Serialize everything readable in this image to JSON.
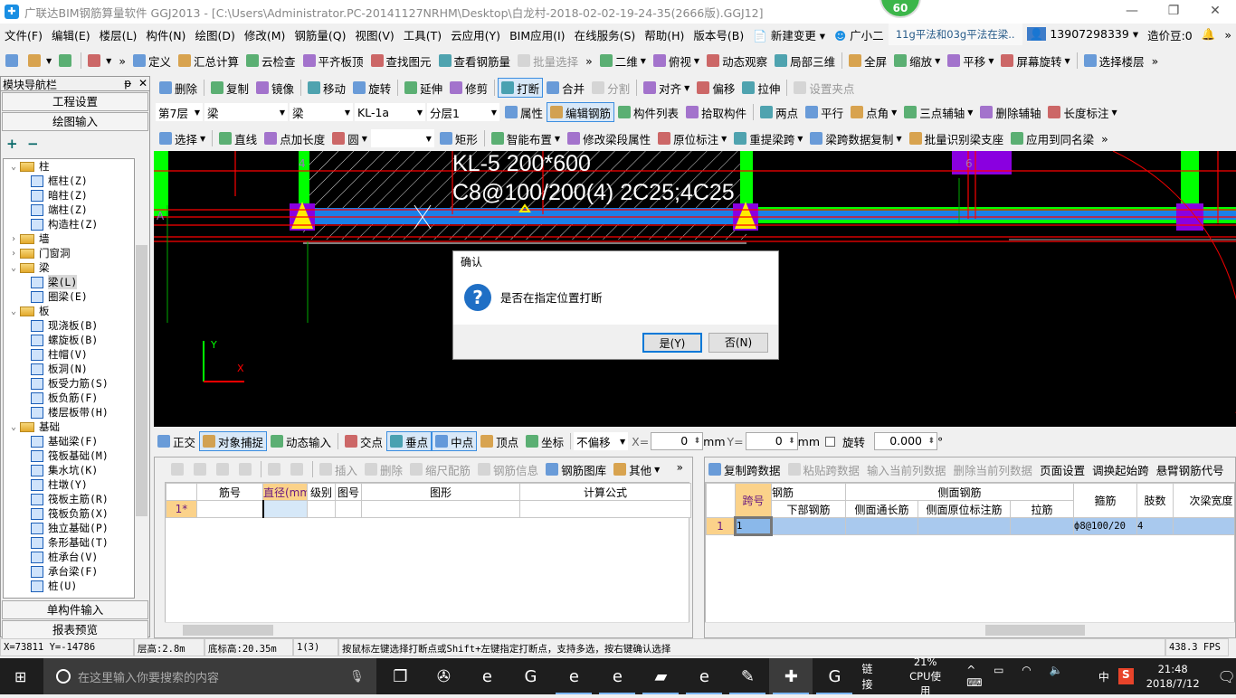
{
  "title": "广联达BIM钢筋算量软件 GGJ2013 - [C:\\Users\\Administrator.PC-20141127NRHM\\Desktop\\白龙村-2018-02-02-19-24-35(2666版).GGJ12]",
  "badge": "60",
  "window_controls": {
    "minimize": "—",
    "restore": "❐",
    "close": "✕"
  },
  "menu": [
    "文件(F)",
    "编辑(E)",
    "楼层(L)",
    "构件(N)",
    "绘图(D)",
    "修改(M)",
    "钢筋量(Q)",
    "视图(V)",
    "工具(T)",
    "云应用(Y)",
    "BIM应用(I)",
    "在线服务(S)",
    "帮助(H)",
    "版本号(B)"
  ],
  "menu_extra": {
    "new_change": "新建变更",
    "assistant": "广小二",
    "news": "11g平法和03g平法在梁..",
    "account": "13907298339",
    "beans": "造价豆:0",
    "more": "»"
  },
  "toolbar1": [
    {
      "label": "",
      "icon": "new-file"
    },
    {
      "label": "",
      "icon": "open-folder",
      "dropdown": true
    },
    {
      "label": "",
      "icon": "save"
    },
    {
      "sep": true
    },
    {
      "label": "",
      "icon": "undo",
      "dropdown": true
    },
    {
      "label": "»",
      "icon": ""
    },
    {
      "label": "定义",
      "icon": "define"
    },
    {
      "label": "汇总计算",
      "icon": "sigma"
    },
    {
      "label": "云检查",
      "icon": "cloud-check"
    },
    {
      "label": "平齐板顶",
      "icon": "align-slab"
    },
    {
      "label": "查找图元",
      "icon": "binoculars"
    },
    {
      "label": "查看钢筋量",
      "icon": "glasses"
    },
    {
      "label": "批量选择",
      "icon": "batch-select",
      "disabled": true
    },
    {
      "label": "»",
      "icon": ""
    },
    {
      "label": "二维",
      "icon": "2d",
      "dropdown": true
    },
    {
      "label": "俯视",
      "icon": "top-view",
      "dropdown": true
    },
    {
      "label": "动态观察",
      "icon": "orbit"
    },
    {
      "label": "局部三维",
      "icon": "local-3d"
    },
    {
      "sep": true
    },
    {
      "label": "全屏",
      "icon": "fullscreen"
    },
    {
      "label": "缩放",
      "icon": "zoom",
      "dropdown": true
    },
    {
      "label": "平移",
      "icon": "pan",
      "dropdown": true
    },
    {
      "label": "屏幕旋转",
      "icon": "screen-rotate",
      "dropdown": true
    },
    {
      "sep": true
    },
    {
      "label": "选择楼层",
      "icon": "select-floor"
    },
    {
      "label": "»",
      "icon": ""
    }
  ],
  "toolbar2": [
    {
      "label": "删除",
      "icon": "delete"
    },
    {
      "sep": true
    },
    {
      "label": "复制",
      "icon": "copy"
    },
    {
      "label": "镜像",
      "icon": "mirror"
    },
    {
      "sep": true
    },
    {
      "label": "移动",
      "icon": "move"
    },
    {
      "label": "旋转",
      "icon": "rotate"
    },
    {
      "sep": true
    },
    {
      "label": "延伸",
      "icon": "extend"
    },
    {
      "label": "修剪",
      "icon": "trim"
    },
    {
      "sep": true
    },
    {
      "label": "打断",
      "icon": "break",
      "active": true
    },
    {
      "label": "合并",
      "icon": "merge"
    },
    {
      "label": "分割",
      "icon": "split",
      "disabled": true
    },
    {
      "sep": true
    },
    {
      "label": "对齐",
      "icon": "align",
      "dropdown": true
    },
    {
      "label": "偏移",
      "icon": "offset"
    },
    {
      "label": "拉伸",
      "icon": "stretch"
    },
    {
      "sep": true
    },
    {
      "label": "设置夹点",
      "icon": "grip",
      "disabled": true
    }
  ],
  "toolbar3_combos": [
    "第7层",
    "梁",
    "梁",
    "KL-1a",
    "分层1"
  ],
  "toolbar3": [
    {
      "label": "属性",
      "icon": "properties"
    },
    {
      "label": "编辑钢筋",
      "icon": "edit-rebar",
      "active": true
    },
    {
      "label": "构件列表",
      "icon": "component-list"
    },
    {
      "label": "拾取构件",
      "icon": "pick"
    },
    {
      "sep": true
    },
    {
      "label": "两点",
      "icon": "two-point"
    },
    {
      "label": "平行",
      "icon": "parallel"
    },
    {
      "label": "点角",
      "icon": "point-angle",
      "dropdown": true
    },
    {
      "label": "三点辅轴",
      "icon": "three-point-axis",
      "dropdown": true
    },
    {
      "label": "删除辅轴",
      "icon": "delete-axis"
    },
    {
      "label": "长度标注",
      "icon": "length-dim",
      "dropdown": true
    }
  ],
  "toolbar4": [
    {
      "label": "选择",
      "icon": "cursor",
      "dropdown": true
    },
    {
      "sep": true
    },
    {
      "label": "直线",
      "icon": "line"
    },
    {
      "label": "点加长度",
      "icon": "point-length"
    },
    {
      "label": "圆",
      "icon": "circle",
      "dropdown": true
    },
    {
      "combo": ""
    },
    {
      "label": "矩形",
      "icon": "rectangle"
    },
    {
      "sep": true
    },
    {
      "label": "智能布置",
      "icon": "smart-layout",
      "dropdown": true
    },
    {
      "label": "修改梁段属性",
      "icon": "modify-beam"
    },
    {
      "label": "原位标注",
      "icon": "in-situ",
      "dropdown": true
    },
    {
      "label": "重提梁跨",
      "icon": "re-span",
      "dropdown": true
    },
    {
      "label": "梁跨数据复制",
      "icon": "span-copy",
      "dropdown": true
    },
    {
      "label": "批量识别梁支座",
      "icon": "batch-support"
    },
    {
      "label": "应用到同名梁",
      "icon": "apply-same"
    },
    {
      "label": "»",
      "icon": ""
    }
  ],
  "nav": {
    "title": "模块导航栏",
    "pin": "ᵽ",
    "close": "✕",
    "project_settings": "工程设置",
    "drawing_input": "绘图输入",
    "single_input": "单构件输入",
    "report": "报表预览",
    "expand": "+",
    "collapse": "−"
  },
  "tree": [
    {
      "label": "柱",
      "level": 0,
      "folder": true,
      "open": true
    },
    {
      "label": "框柱(Z)",
      "level": 1
    },
    {
      "label": "暗柱(Z)",
      "level": 1
    },
    {
      "label": "端柱(Z)",
      "level": 1
    },
    {
      "label": "构造柱(Z)",
      "level": 1
    },
    {
      "label": "墙",
      "level": 0,
      "folder": true,
      "open": false
    },
    {
      "label": "门窗洞",
      "level": 0,
      "folder": true,
      "open": false
    },
    {
      "label": "梁",
      "level": 0,
      "folder": true,
      "open": true
    },
    {
      "label": "梁(L)",
      "level": 1,
      "selected": true
    },
    {
      "label": "圈梁(E)",
      "level": 1
    },
    {
      "label": "板",
      "level": 0,
      "folder": true,
      "open": true
    },
    {
      "label": "现浇板(B)",
      "level": 1
    },
    {
      "label": "螺旋板(B)",
      "level": 1
    },
    {
      "label": "柱帽(V)",
      "level": 1
    },
    {
      "label": "板洞(N)",
      "level": 1
    },
    {
      "label": "板受力筋(S)",
      "level": 1
    },
    {
      "label": "板负筋(F)",
      "level": 1
    },
    {
      "label": "楼层板带(H)",
      "level": 1
    },
    {
      "label": "基础",
      "level": 0,
      "folder": true,
      "open": true
    },
    {
      "label": "基础梁(F)",
      "level": 1
    },
    {
      "label": "筏板基础(M)",
      "level": 1
    },
    {
      "label": "集水坑(K)",
      "level": 1
    },
    {
      "label": "柱墩(Y)",
      "level": 1
    },
    {
      "label": "筏板主筋(R)",
      "level": 1
    },
    {
      "label": "筏板负筋(X)",
      "level": 1
    },
    {
      "label": "独立基础(P)",
      "level": 1
    },
    {
      "label": "条形基础(T)",
      "level": 1
    },
    {
      "label": "桩承台(V)",
      "level": 1
    },
    {
      "label": "承台梁(F)",
      "level": 1
    },
    {
      "label": "桩(U)",
      "level": 1
    }
  ],
  "cad": {
    "beam_label": "KL-5 200*600",
    "beam_rebar": "C8@100/200(4) 2C25;4C25",
    "axis_4": "4",
    "axis_5": "5",
    "axis_6": "6",
    "axis_a": "A",
    "y_axis": "Y",
    "x_axis": "X",
    "colors": {
      "column": "#00ff00",
      "beam": "#1a7fe8",
      "grid": "#ff0000",
      "support": "#ffee00",
      "purple": "#8a00e0"
    }
  },
  "dialog": {
    "title": "确认",
    "message": "是否在指定位置打断",
    "yes": "是(Y)",
    "no": "否(N)"
  },
  "snapbar": {
    "items": [
      {
        "label": "正交",
        "icon": "orthogonal"
      },
      {
        "label": "对象捕捉",
        "icon": "object-snap",
        "active": true
      },
      {
        "label": "动态输入",
        "icon": "dynamic-input"
      },
      {
        "sep": true
      },
      {
        "label": "交点",
        "icon": "intersection"
      },
      {
        "label": "垂点",
        "icon": "perpendicular",
        "active": true
      },
      {
        "label": "中点",
        "icon": "midpoint",
        "active": true
      },
      {
        "label": "顶点",
        "icon": "vertex"
      },
      {
        "label": "坐标",
        "icon": "coordinate"
      }
    ],
    "offset": "不偏移",
    "x_label": "X=",
    "x": "0",
    "y_label": "Y=",
    "y": "0",
    "unit": "mm",
    "rotate_label": "旋转",
    "rotate": "0.000",
    "degree": "°"
  },
  "rebar_panel": {
    "toolbar": [
      {
        "label": "",
        "icon": "first",
        "disabled": true
      },
      {
        "label": "",
        "icon": "prev",
        "disabled": true
      },
      {
        "label": "",
        "icon": "next",
        "disabled": true
      },
      {
        "label": "",
        "icon": "last",
        "disabled": true
      },
      {
        "sep": true
      },
      {
        "label": "",
        "icon": "up",
        "disabled": true
      },
      {
        "label": "",
        "icon": "down",
        "disabled": true
      },
      {
        "sep": true
      },
      {
        "label": "插入",
        "icon": "insert",
        "disabled": true
      },
      {
        "label": "删除",
        "icon": "delete",
        "disabled": true
      },
      {
        "label": "缩尺配筋",
        "icon": "scale-rebar",
        "disabled": true
      },
      {
        "label": "钢筋信息",
        "icon": "rebar-info",
        "disabled": true
      },
      {
        "label": "钢筋图库",
        "icon": "rebar-library"
      },
      {
        "label": "其他",
        "icon": "other",
        "dropdown": true
      }
    ],
    "more": "»",
    "columns": [
      "",
      "筋号",
      "直径(mm)",
      "级别",
      "图号",
      "图形",
      "计算公式"
    ],
    "rows": [
      [
        "1*",
        "",
        "",
        "",
        "",
        "",
        ""
      ]
    ]
  },
  "span_panel": {
    "toolbar": [
      {
        "label": "复制跨数据",
        "icon": "copy-span"
      },
      {
        "label": "粘贴跨数据",
        "icon": "paste-span",
        "disabled": true
      },
      {
        "label": "输入当前列数据",
        "icon": "",
        "disabled": true
      },
      {
        "label": "删除当前列数据",
        "icon": "",
        "disabled": true
      },
      {
        "label": "页面设置",
        "icon": ""
      },
      {
        "label": "调换起始跨",
        "icon": ""
      },
      {
        "label": "悬臂钢筋代号",
        "icon": ""
      }
    ],
    "header_top": [
      "跨号",
      "钢筋",
      "侧面钢筋",
      "箍筋",
      "肢数",
      "次梁宽度"
    ],
    "header_sub": [
      "下部钢筋",
      "侧面通长筋",
      "侧面原位标注筋",
      "拉筋"
    ],
    "rows": [
      [
        "1",
        "1",
        "",
        "",
        "",
        "",
        "ф8@100/20",
        "4",
        ""
      ]
    ]
  },
  "status": [
    "X=73811 Y=-14786",
    "层高:2.8m",
    "底标高:20.35m",
    "1(3)",
    "按鼠标左键选择打断点或Shift+左键指定打断点，支持多选，按右键确认选择",
    "438.3 FPS"
  ],
  "taskbar": {
    "search_placeholder": "在这里输入你要搜索的内容",
    "apps": [
      {
        "icon": "task-view",
        "g": "❐"
      },
      {
        "icon": "fan-app",
        "g": "✇"
      },
      {
        "icon": "ie-gray",
        "g": "e"
      },
      {
        "icon": "swirl-app",
        "g": "G"
      },
      {
        "icon": "edge",
        "g": "e",
        "run": true
      },
      {
        "icon": "ie",
        "g": "e",
        "run": true
      },
      {
        "icon": "file-explorer",
        "g": "▰",
        "run": true
      },
      {
        "icon": "browser-green",
        "g": "e",
        "run": true
      },
      {
        "icon": "notes-app",
        "g": "✎",
        "run": true
      },
      {
        "icon": "glodon-app",
        "g": "✚",
        "run": true,
        "cur": true
      },
      {
        "icon": "glodon-g",
        "g": "G",
        "run": true
      }
    ],
    "link": "链接",
    "cpu": "21%",
    "cpu_label": "CPU使用",
    "ime": "中",
    "time": "21:48",
    "date": "2018/7/12"
  }
}
